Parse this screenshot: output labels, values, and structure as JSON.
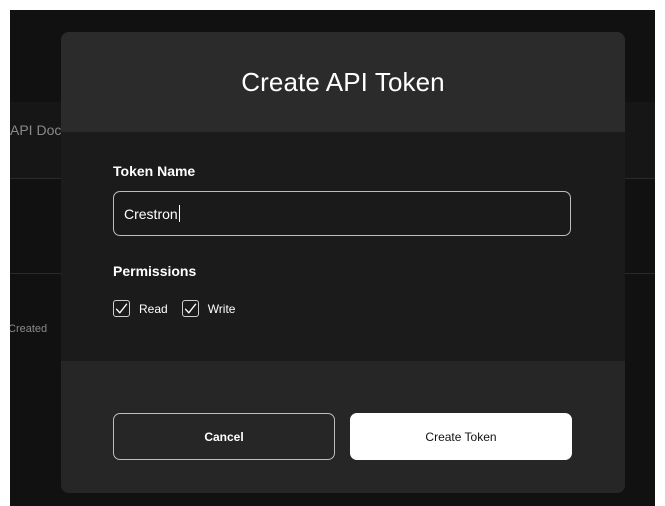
{
  "background": {
    "doc_text": "API Doc",
    "created_text": "Created"
  },
  "modal": {
    "title": "Create API Token",
    "token_name_label": "Token Name",
    "token_name_value": "Crestron",
    "permissions_label": "Permissions",
    "permissions": [
      {
        "label": "Read",
        "checked": true
      },
      {
        "label": "Write",
        "checked": true
      }
    ],
    "cancel_label": "Cancel",
    "create_label": "Create Token"
  },
  "colors": {
    "backdrop": "#111111",
    "modal_header": "#2b2b2b",
    "modal_body": "#1b1b1b",
    "modal_footer": "#262626",
    "primary_button": "#ffffff"
  },
  "icons": {
    "checkbox": "checkmark-icon"
  }
}
